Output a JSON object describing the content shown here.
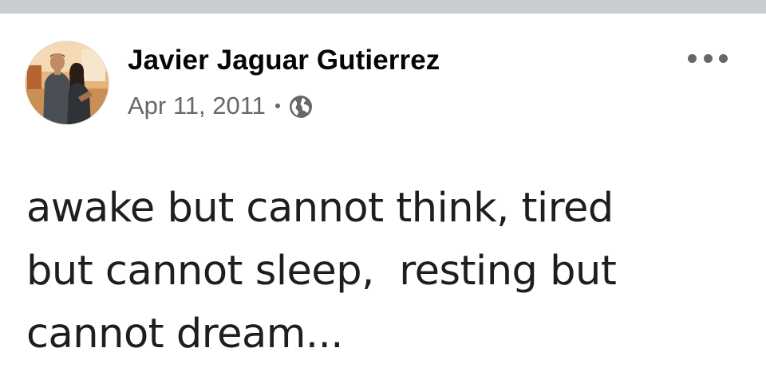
{
  "post": {
    "author_name": "Javier Jaguar Gutierrez",
    "date": "Apr 11, 2011",
    "separator": "·",
    "privacy_icon": "globe-icon",
    "more_icon": "more-options-icon",
    "text_lines": [
      "awake but cannot think, tired",
      "but cannot sleep,  resting but",
      "cannot dream..."
    ]
  },
  "colors": {
    "top_strip": "#c9ccd1",
    "author_text": "#050505",
    "meta_text": "#65676b",
    "body_text": "#1c1e21",
    "background": "#ffffff"
  }
}
